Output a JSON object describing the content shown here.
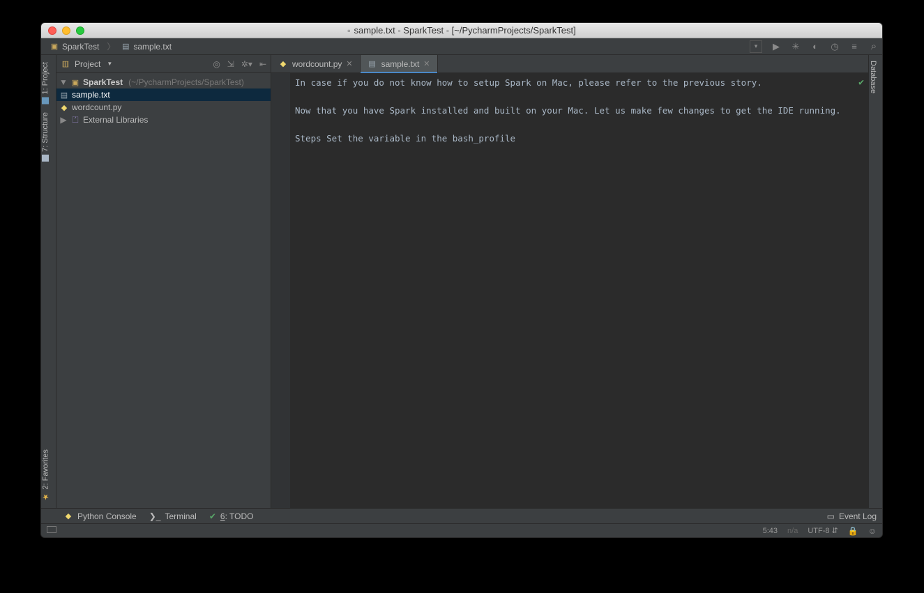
{
  "window": {
    "title": "sample.txt - SparkTest - [~/PycharmProjects/SparkTest]"
  },
  "breadcrumb": [
    {
      "icon": "folder",
      "label": "SparkTest"
    },
    {
      "icon": "file",
      "label": "sample.txt"
    }
  ],
  "sidebar_left": {
    "tabs": [
      "1: Project",
      "7: Structure",
      "2: Favorites"
    ]
  },
  "sidebar_right": {
    "tabs": [
      "Database"
    ]
  },
  "project_panel": {
    "title": "Project",
    "root": {
      "name": "SparkTest",
      "path": "(~/PycharmProjects/SparkTest)"
    },
    "children": [
      {
        "name": "sample.txt",
        "icon": "file",
        "selected": true
      },
      {
        "name": "wordcount.py",
        "icon": "py"
      }
    ],
    "external": "External Libraries"
  },
  "editor": {
    "tabs": [
      {
        "name": "wordcount.py",
        "icon": "py",
        "active": false
      },
      {
        "name": "sample.txt",
        "icon": "file",
        "active": true
      }
    ],
    "content_lines": [
      "In case if you do not know how to setup Spark on Mac, please refer to the previous story.",
      "",
      "Now that you have Spark installed and built on your Mac. Let us make few changes to get the IDE running.",
      "",
      "Steps Set the variable in the bash_profile"
    ]
  },
  "bottom_tools": {
    "items": [
      {
        "icon": "py",
        "label": "Python Console"
      },
      {
        "icon": "term",
        "label": "Terminal"
      },
      {
        "icon": "todo",
        "label": "6: TODO",
        "mn": "6"
      }
    ],
    "event_log": "Event Log"
  },
  "status": {
    "cursor": "5:43",
    "readonly": "n/a",
    "encoding": "UTF-8"
  }
}
